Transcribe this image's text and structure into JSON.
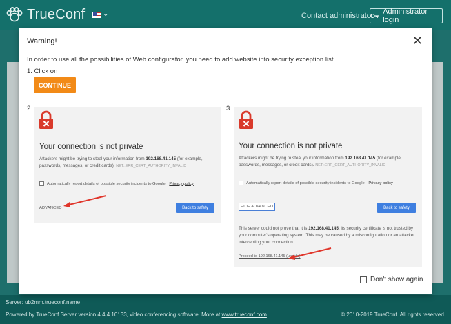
{
  "header": {
    "brand": "TrueConf",
    "contact_label": "Contact administrator",
    "admin_login_label": "Administrator login",
    "icons": [
      "trueconf-paw-logo",
      "us-flag-icon",
      "chevron-down-icon",
      "key-icon"
    ]
  },
  "modal": {
    "title": "Warning!",
    "close_symbol": "✕",
    "intro": "In order to use all the possibilities of Web configurator, you need to add website into security exception list.",
    "step1_label": "1. Click on",
    "continue_label": "CONTINUE",
    "step2_label": "2.",
    "step3_label": "3.",
    "dont_show_label": "Don't show again"
  },
  "shot": {
    "heading": "Your connection is not private",
    "body_pre": "Attackers might be trying to steal your information from ",
    "host": "192.168.41.145",
    "body_post": " (for example, passwords, messages, or credit cards).",
    "error_code": "NET::ERR_CERT_AUTHORITY_INVALID",
    "report_text": "Automatically report details of possible security incidents to Google.",
    "privacy_link": "Privacy policy",
    "advanced_label": "ADVANCED",
    "hide_advanced_label": "HIDE ADVANCED",
    "back_label": "Back to safety",
    "more_pre": "This server could not prove that it is ",
    "more_post": "; its security certificate is not trusted by your computer's operating system. This may be caused by a misconfiguration or an attacker intercepting your connection.",
    "proceed_link": "Proceed to 192.168.41.145 (unsafe)"
  },
  "footer": {
    "server": "Server: ub2mm.trueconf.name",
    "powered_pre": "Powered by TrueConf Server version 4.4.4.10133, video conferencing software. More at ",
    "powered_link": "www.trueconf.com",
    "powered_post": ".",
    "copyright": "© 2010-2019 TrueConf. All rights reserved."
  },
  "colors": {
    "teal_bg": "#1e6f6c",
    "accent_orange": "#f28a17",
    "chrome_blue": "#3f7fe0",
    "lock_red": "#d93a2b",
    "arrow_red": "#e0352a"
  }
}
